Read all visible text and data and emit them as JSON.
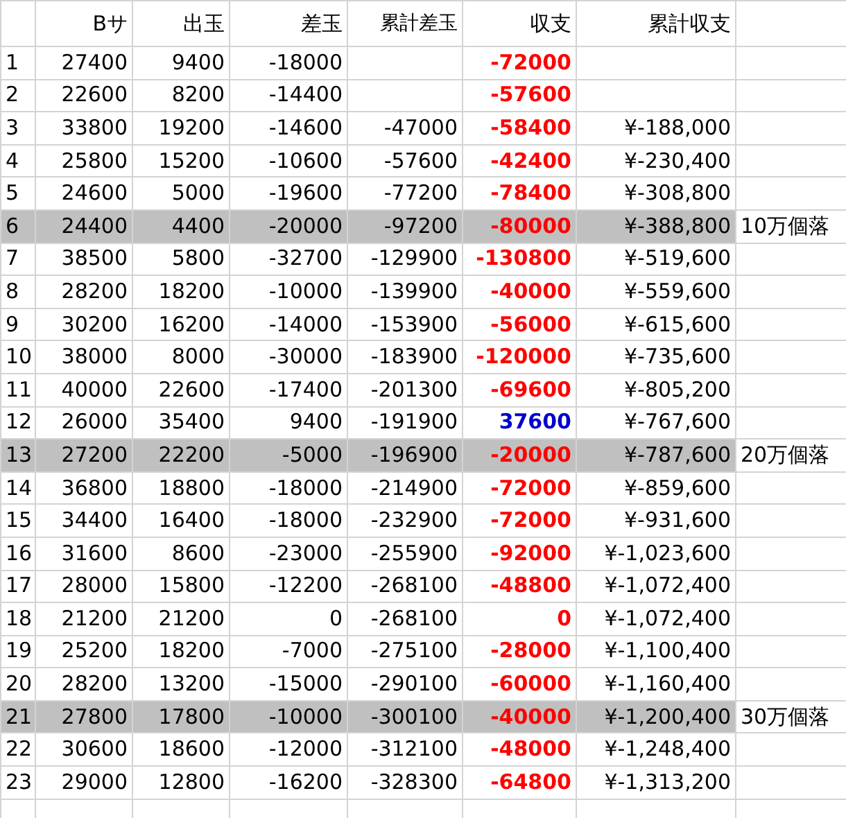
{
  "columns": [
    "Bサ",
    "出玉",
    "差玉",
    "累計差玉",
    "収支",
    "累計収支"
  ],
  "rows": [
    {
      "no": "1",
      "b": "27400",
      "out": "9400",
      "diff": "-18000",
      "profit": "-72000",
      "color": "#ff0000",
      "highlighted": false
    },
    {
      "no": "2",
      "b": "22600",
      "out": "8200",
      "diff": "-14400",
      "profit": "-57600",
      "color": "#ff0000",
      "highlighted": false
    },
    {
      "no": "3",
      "b": "33800",
      "out": "19200",
      "diff": "-14600",
      "cum_diff": "-47000",
      "profit": "-58400",
      "color": "#ff0000",
      "cum_profit": "¥-188,000",
      "highlighted": false
    },
    {
      "no": "4",
      "b": "25800",
      "out": "15200",
      "diff": "-10600",
      "cum_diff": "-57600",
      "profit": "-42400",
      "color": "#ff0000",
      "cum_profit": "¥-230,400",
      "highlighted": false
    },
    {
      "no": "5",
      "b": "24600",
      "out": "5000",
      "diff": "-19600",
      "cum_diff": "-77200",
      "profit": "-78400",
      "color": "#ff0000",
      "cum_profit": "¥-308,800",
      "highlighted": false
    },
    {
      "no": "6",
      "b": "24400",
      "out": "4400",
      "diff": "-20000",
      "cum_diff": "-97200",
      "profit": "-80000",
      "color": "#ff0000",
      "cum_profit": "¥-388,800",
      "highlighted": true,
      "note": "10万個落"
    },
    {
      "no": "7",
      "b": "38500",
      "out": "5800",
      "diff": "-32700",
      "cum_diff": "-129900",
      "profit": "-130800",
      "color": "#ff0000",
      "cum_profit": "¥-519,600",
      "highlighted": false
    },
    {
      "no": "8",
      "b": "28200",
      "out": "18200",
      "diff": "-10000",
      "cum_diff": "-139900",
      "profit": "-40000",
      "color": "#ff0000",
      "cum_profit": "¥-559,600",
      "highlighted": false
    },
    {
      "no": "9",
      "b": "30200",
      "out": "16200",
      "diff": "-14000",
      "cum_diff": "-153900",
      "profit": "-56000",
      "color": "#ff0000",
      "cum_profit": "¥-615,600",
      "highlighted": false
    },
    {
      "no": "10",
      "b": "38000",
      "out": "8000",
      "diff": "-30000",
      "cum_diff": "-183900",
      "profit": "-120000",
      "color": "#ff0000",
      "cum_profit": "¥-735,600",
      "highlighted": false
    },
    {
      "no": "11",
      "b": "40000",
      "out": "22600",
      "diff": "-17400",
      "cum_diff": "-201300",
      "profit": "-69600",
      "color": "#ff0000",
      "cum_profit": "¥-805,200",
      "highlighted": false
    },
    {
      "no": "12",
      "b": "26000",
      "out": "35400",
      "diff": "9400",
      "cum_diff": "-191900",
      "profit": "37600",
      "color": "#0000cc",
      "cum_profit": "¥-767,600",
      "highlighted": false
    },
    {
      "no": "13",
      "b": "27200",
      "out": "22200",
      "diff": "-5000",
      "cum_diff": "-196900",
      "profit": "-20000",
      "color": "#ff0000",
      "cum_profit": "¥-787,600",
      "highlighted": true,
      "note": "20万個落"
    },
    {
      "no": "14",
      "b": "36800",
      "out": "18800",
      "diff": "-18000",
      "cum_diff": "-214900",
      "profit": "-72000",
      "color": "#ff0000",
      "cum_profit": "¥-859,600",
      "highlighted": false
    },
    {
      "no": "15",
      "b": "34400",
      "out": "16400",
      "diff": "-18000",
      "cum_diff": "-232900",
      "profit": "-72000",
      "color": "#ff0000",
      "cum_profit": "¥-931,600",
      "highlighted": false
    },
    {
      "no": "16",
      "b": "31600",
      "out": "8600",
      "diff": "-23000",
      "cum_diff": "-255900",
      "profit": "-92000",
      "color": "#ff0000",
      "cum_profit": "¥-1,023,600",
      "highlighted": false
    },
    {
      "no": "17",
      "b": "28000",
      "out": "15800",
      "diff": "-12200",
      "cum_diff": "-268100",
      "profit": "-48800",
      "color": "#ff0000",
      "cum_profit": "¥-1,072,400",
      "highlighted": false
    },
    {
      "no": "18",
      "b": "21200",
      "out": "21200",
      "diff": "0",
      "cum_diff": "-268100",
      "profit": "0",
      "color": "#ff0000",
      "cum_profit": "¥-1,072,400",
      "highlighted": false
    },
    {
      "no": "19",
      "b": "25200",
      "out": "18200",
      "diff": "-7000",
      "cum_diff": "-275100",
      "profit": "-28000",
      "color": "#ff0000",
      "cum_profit": "¥-1,100,400",
      "highlighted": false
    },
    {
      "no": "20",
      "b": "28200",
      "out": "13200",
      "diff": "-15000",
      "cum_diff": "-290100",
      "profit": "-60000",
      "color": "#ff0000",
      "cum_profit": "¥-1,160,400",
      "highlighted": false
    },
    {
      "no": "21",
      "b": "27800",
      "out": "17800",
      "diff": "-10000",
      "cum_diff": "-300100",
      "profit": "-40000",
      "color": "#ff0000",
      "cum_profit": "¥-1,200,400",
      "highlighted": true,
      "note": "30万個落"
    },
    {
      "no": "22",
      "b": "30600",
      "out": "18600",
      "diff": "-12000",
      "cum_diff": "-312100",
      "profit": "-48000",
      "color": "#ff0000",
      "cum_profit": "¥-1,248,400",
      "highlighted": false
    },
    {
      "no": "23",
      "b": "29000",
      "out": "12800",
      "diff": "-16200",
      "cum_diff": "-328300",
      "profit": "-64800",
      "color": "#ff0000",
      "cum_profit": "¥-1,313,200",
      "highlighted": false
    }
  ]
}
